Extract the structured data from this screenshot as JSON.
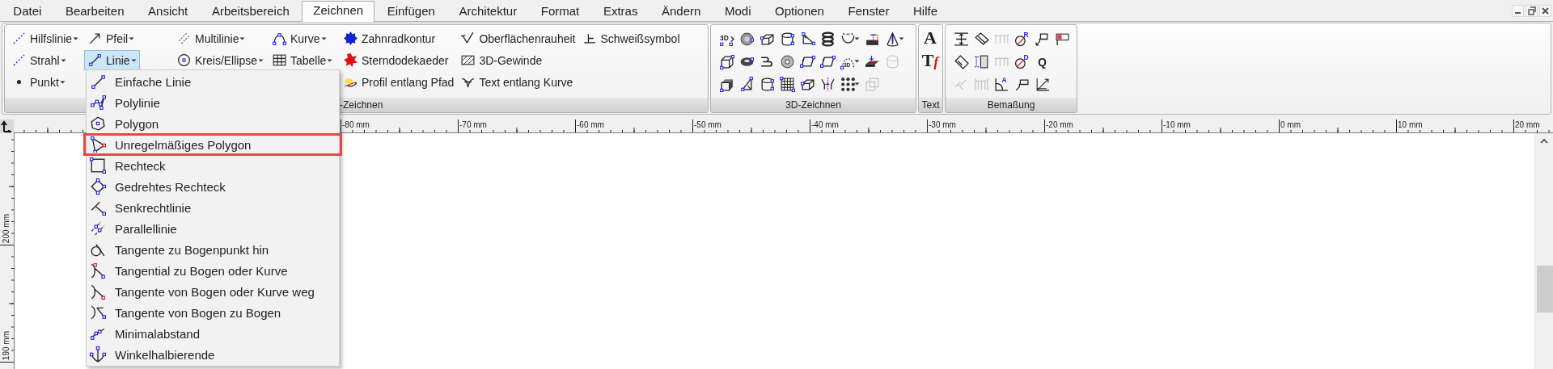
{
  "menu_bar": {
    "items": [
      {
        "label": "Datei",
        "selected": false
      },
      {
        "label": "Bearbeiten",
        "selected": false
      },
      {
        "label": "Ansicht",
        "selected": false
      },
      {
        "label": "Arbeitsbereich",
        "selected": false
      },
      {
        "label": "Zeichnen",
        "selected": true
      },
      {
        "label": "Einfügen",
        "selected": false
      },
      {
        "label": "Architektur",
        "selected": false
      },
      {
        "label": "Format",
        "selected": false
      },
      {
        "label": "Extras",
        "selected": false
      },
      {
        "label": "Ändern",
        "selected": false
      },
      {
        "label": "Modi",
        "selected": false
      },
      {
        "label": "Optionen",
        "selected": false
      },
      {
        "label": "Fenster",
        "selected": false
      },
      {
        "label": "Hilfe",
        "selected": false
      }
    ]
  },
  "ribbon": {
    "groups": [
      {
        "kind": "commands",
        "label": "-Zeichnen",
        "columns": [
          [
            {
              "label": "Hilfslinie",
              "dropdown": true,
              "selected": false
            },
            {
              "label": "Strahl",
              "dropdown": true,
              "selected": false
            },
            {
              "label": "Punkt",
              "dropdown": true,
              "selected": false
            }
          ],
          [
            {
              "label": "Pfeil",
              "dropdown": true,
              "selected": false
            },
            {
              "label": "Linie",
              "dropdown": true,
              "selected": true
            }
          ],
          [
            {
              "label": "Multilinie",
              "dropdown": true,
              "selected": false
            },
            {
              "label": "Kreis/Ellipse",
              "dropdown": true,
              "selected": false
            }
          ],
          [
            {
              "label": "Kurve",
              "dropdown": true,
              "selected": false
            },
            {
              "label": "Tabelle",
              "dropdown": true,
              "selected": false
            }
          ],
          [
            {
              "label": "Zahnradkontur",
              "dropdown": false,
              "selected": false
            },
            {
              "label": "Sterndodekaeder",
              "dropdown": false,
              "selected": false
            },
            {
              "label": "Profil entlang Pfad",
              "dropdown": false,
              "selected": false
            }
          ],
          [
            {
              "label": "Oberflächenrauheit",
              "dropdown": false,
              "selected": false
            },
            {
              "label": "3D-Gewinde",
              "dropdown": false,
              "selected": false
            },
            {
              "label": "Text entlang Kurve",
              "dropdown": false,
              "selected": false
            }
          ],
          [
            {
              "label": "Schweißsymbol",
              "dropdown": false,
              "selected": false
            }
          ]
        ]
      },
      {
        "kind": "icons",
        "label": "3D-Zeichnen",
        "rows": [
          [
            {
              "glyph": "3D",
              "dropdown": false,
              "disabled": false
            },
            {
              "dropdown": false,
              "disabled": false
            },
            {
              "dropdown": false,
              "disabled": false
            },
            {
              "dropdown": false,
              "disabled": false
            },
            {
              "dropdown": false,
              "disabled": false
            },
            {
              "dropdown": false,
              "disabled": false
            },
            {
              "dropdown": true,
              "disabled": false
            },
            {
              "dropdown": false,
              "disabled": false
            },
            {
              "dropdown": true,
              "disabled": false
            }
          ],
          [
            {
              "dropdown": false,
              "disabled": false
            },
            {
              "dropdown": false,
              "disabled": false
            },
            {
              "dropdown": false,
              "disabled": false
            },
            {
              "dropdown": false,
              "disabled": false
            },
            {
              "dropdown": false,
              "disabled": false
            },
            {
              "dropdown": false,
              "disabled": false
            },
            {
              "glyph": "3D",
              "dropdown": true,
              "disabled": false
            },
            {
              "dropdown": false,
              "disabled": false
            },
            {
              "dropdown": false,
              "disabled": true
            }
          ],
          [
            {
              "dropdown": false,
              "disabled": false
            },
            {
              "dropdown": false,
              "disabled": false
            },
            {
              "dropdown": false,
              "disabled": false
            },
            {
              "dropdown": false,
              "disabled": false
            },
            {
              "dropdown": false,
              "disabled": false
            },
            {
              "dropdown": false,
              "disabled": false
            },
            {
              "dropdown": true,
              "disabled": false
            },
            {
              "dropdown": false,
              "disabled": true
            }
          ]
        ]
      },
      {
        "kind": "letters",
        "label": "Text",
        "rows": [
          [
            {
              "glyph": "A",
              "disabled": false
            }
          ],
          [
            {
              "glyph": "T",
              "accent": "f",
              "disabled": false
            }
          ]
        ]
      },
      {
        "kind": "icons",
        "label": "Bemaßung",
        "rows": [
          [
            {
              "dropdown": false,
              "disabled": false
            },
            {
              "dropdown": false,
              "disabled": false
            },
            {
              "dropdown": false,
              "disabled": true
            },
            {
              "glyph": "R",
              "dropdown": false,
              "disabled": false
            },
            {
              "dropdown": false,
              "disabled": false
            },
            {
              "dropdown": false,
              "disabled": false
            }
          ],
          [
            {
              "dropdown": false,
              "disabled": false
            },
            {
              "dropdown": false,
              "disabled": false
            },
            {
              "dropdown": false,
              "disabled": true
            },
            {
              "glyph": "D",
              "dropdown": false,
              "disabled": false
            },
            {
              "glyph": "Q",
              "dropdown": false,
              "disabled": false
            }
          ],
          [
            {
              "dropdown": false,
              "disabled": true
            },
            {
              "dropdown": false,
              "disabled": true
            },
            {
              "glyph": "A",
              "dropdown": false,
              "disabled": false
            },
            {
              "dropdown": false,
              "disabled": false
            },
            {
              "dropdown": false,
              "disabled": false
            }
          ]
        ]
      }
    ]
  },
  "dropdown_menu": {
    "items": [
      {
        "label": "Einfache Linie",
        "selected": false
      },
      {
        "label": "Polylinie",
        "selected": false
      },
      {
        "label": "Polygon",
        "selected": false
      },
      {
        "label": "Unregelmäßiges Polygon",
        "selected": true
      },
      {
        "label": "Rechteck",
        "selected": false
      },
      {
        "label": "Gedrehtes Rechteck",
        "selected": false
      },
      {
        "label": "Senkrechtlinie",
        "selected": false
      },
      {
        "label": "Parallellinie",
        "selected": false
      },
      {
        "label": "Tangente zu Bogenpunkt hin",
        "selected": false
      },
      {
        "label": "Tangential zu Bogen oder Kurve",
        "selected": false
      },
      {
        "label": "Tangente von Bogen oder Kurve weg",
        "selected": false
      },
      {
        "label": "Tangente von Bogen zu Bogen",
        "selected": false
      },
      {
        "label": "Minimalabstand",
        "selected": false
      },
      {
        "label": "Winkelhalbierende",
        "selected": false
      }
    ]
  },
  "ruler_horizontal": {
    "labels": [
      "-80 mm",
      "-70 mm",
      "-60 mm",
      "-50 mm",
      "-40 mm",
      "-30 mm",
      "-20 mm",
      "-10 mm",
      "0 mm",
      "10 mm",
      "20 mm"
    ]
  },
  "ruler_vertical": {
    "labels": [
      "200 mm",
      "190 mm"
    ]
  }
}
